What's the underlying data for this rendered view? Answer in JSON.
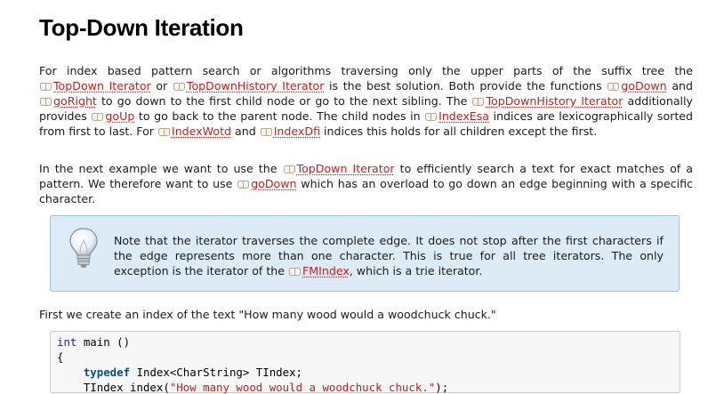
{
  "page": {
    "title": "Top-Down Iteration"
  },
  "para1": [
    {
      "t": "For index based pattern search or algorithms traversing only the upper parts of the suffix tree the "
    },
    {
      "t": "TopDown Iterator",
      "link": true
    },
    {
      "t": " or "
    },
    {
      "t": "TopDownHistory Iterator",
      "link": true
    },
    {
      "t": " is the best solution. Both provide the functions "
    },
    {
      "t": "goDown",
      "link": true
    },
    {
      "t": " and "
    },
    {
      "t": "goRight",
      "link": true
    },
    {
      "t": " to go down to the first child node or go to the next sibling. The "
    },
    {
      "t": "TopDownHistory Iterator",
      "link": true
    },
    {
      "t": " additionally provides "
    },
    {
      "t": "goUp",
      "link": true
    },
    {
      "t": " to go back to the parent node. The child nodes in "
    },
    {
      "t": "IndexEsa",
      "link": true
    },
    {
      "t": " indices are lexicographically sorted from first to last. For "
    },
    {
      "t": "IndexWotd",
      "link": true
    },
    {
      "t": " and "
    },
    {
      "t": "IndexDfi",
      "link": true
    },
    {
      "t": " indices this holds for all children except the first."
    }
  ],
  "para2": [
    {
      "t": "In the next example we want to use the "
    },
    {
      "t": "TopDown Iterator",
      "link": true
    },
    {
      "t": " to efficiently search a text for exact matches of a pattern. We therefore want to use "
    },
    {
      "t": "goDown",
      "link": true
    },
    {
      "t": " which has an overload to go down an edge beginning with a specific character."
    }
  ],
  "note": {
    "icon": "lightbulb-icon",
    "runs": [
      {
        "t": "Note that the iterator traverses the complete edge. It does not stop after the first characters if the edge represents more than one character. This is true for all tree iterators. The only exception is the iterator of the "
      },
      {
        "t": "FMIndex",
        "link": true
      },
      {
        "t": ", which is a trie iterator."
      }
    ]
  },
  "para3": [
    {
      "t": "First we create an index of the text \"How many wood would a woodchuck chuck.\""
    }
  ],
  "code": {
    "lines": [
      [
        {
          "t": "int",
          "c": "kw"
        },
        {
          "t": " main ()"
        }
      ],
      [
        {
          "t": "{"
        }
      ],
      [
        {
          "t": "    "
        },
        {
          "t": "typedef",
          "c": "kwb"
        },
        {
          "t": " Index<CharString> TIndex;"
        }
      ],
      [
        {
          "t": "    TIndex index("
        },
        {
          "t": "\"How many wood would a woodchuck chuck.\"",
          "c": "str"
        },
        {
          "t": ");"
        }
      ]
    ]
  },
  "colors": {
    "link": "#c51d1d",
    "note_bg": "#dcebf6",
    "note_border": "#9dc3de",
    "code_bg": "#f7f7f7"
  }
}
